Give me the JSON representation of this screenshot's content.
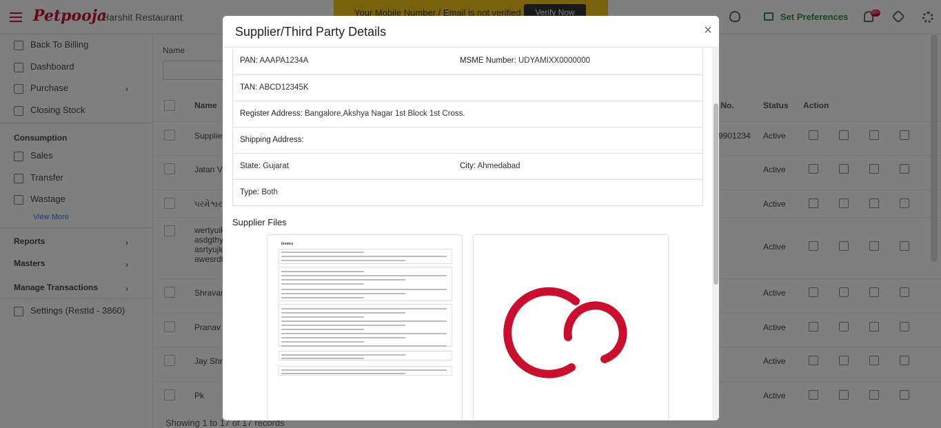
{
  "app": {
    "logo": "Petpooja",
    "restaurant": "Harshit Restaurant",
    "verify_msg": "Your Mobile Number / Email is not verified",
    "verify_btn": "Verify Now",
    "set_preferences": "Set Preferences",
    "notif_count": "99+"
  },
  "sidebar": {
    "back": "Back To Billing",
    "dashboard": "Dashboard",
    "purchase": "Purchase",
    "closing_stock": "Closing Stock",
    "consumption": "Consumption",
    "sales": "Sales",
    "transfer": "Transfer",
    "wastage": "Wastage",
    "view_more": "View More",
    "reports": "Reports",
    "masters": "Masters",
    "manage": "Manage Transactions",
    "settings": "Settings (RestId - 3860)"
  },
  "table": {
    "filter_label": "Name",
    "headers": {
      "name": "Name",
      "phone": "... No.",
      "status": "Status",
      "action": "Action"
    },
    "rows": [
      {
        "name": "Supplier",
        "phone": "9901234",
        "status": "Active"
      },
      {
        "name": "Jatan Vi",
        "phone": "",
        "status": "Active"
      },
      {
        "name": "પરમેશ્વર",
        "phone": "",
        "status": "Active"
      },
      {
        "name": "wertyuik\nasdgthy\nasrtyujk\nawesrdt",
        "phone": "",
        "status": "Active"
      },
      {
        "name": "Shravan",
        "phone": "",
        "status": "Active"
      },
      {
        "name": "Pranav",
        "phone": "",
        "status": "Active"
      },
      {
        "name": "Jay Shre",
        "phone": "",
        "status": "Active"
      },
      {
        "name": "Pk",
        "phone": "",
        "status": "Active"
      }
    ],
    "footer": "Showing 1 to 17 of 17 records"
  },
  "modal": {
    "title": "Supplier/Third Party Details",
    "pan_label": "PAN:",
    "pan": "AAAPA1234A",
    "msme_label": "MSME Number:",
    "msme": "UDYAMIXX0000000",
    "tan_label": "TAN:",
    "tan": "ABCD12345K",
    "register_label": "Register Address:",
    "register": "Bangalore,Akshya Nagar 1st Block 1st Cross.",
    "shipping_label": "Shipping Address:",
    "shipping": "",
    "state_label": "State:",
    "state": "Gujarat",
    "city_label": "City:",
    "city": "Ahmedabad",
    "type_label": "Type:",
    "type": "Both",
    "files_title": "Supplier Files",
    "invoice_title": "Invoice"
  },
  "colors": {
    "brand": "#c8102e",
    "banner": "#f5c518",
    "pref_green": "#2e8b57"
  }
}
